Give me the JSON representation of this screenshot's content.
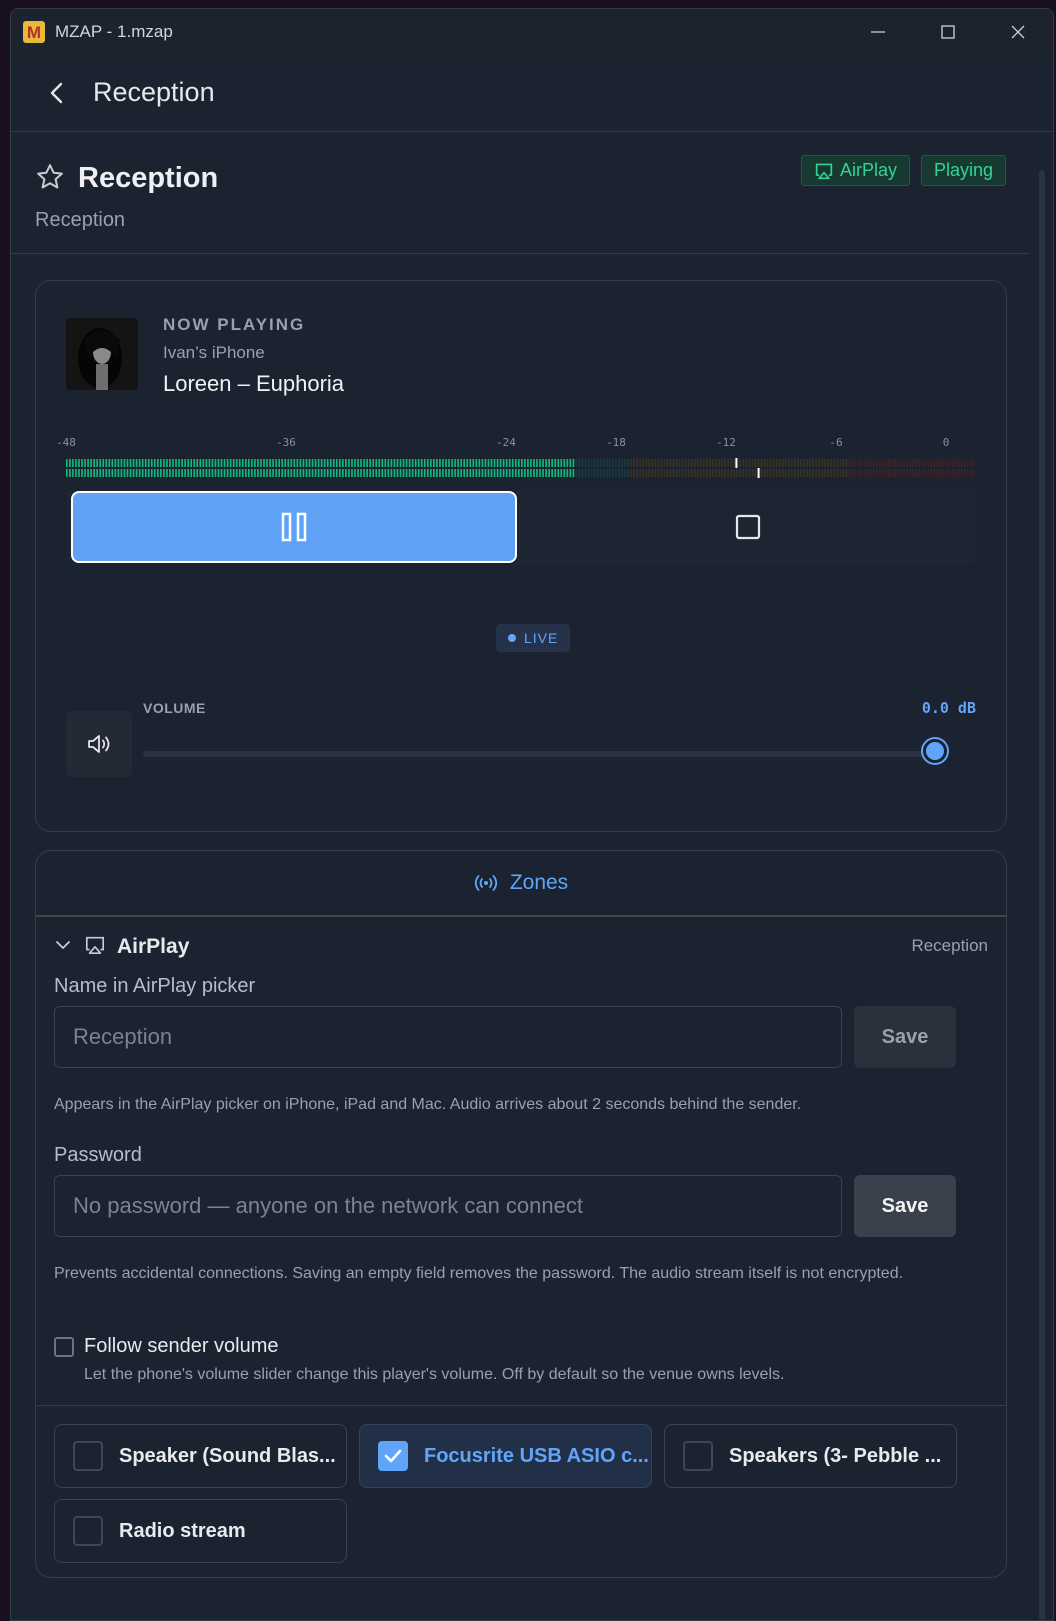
{
  "window": {
    "title": "MZAP - 1.mzap"
  },
  "header": {
    "title": "Reception"
  },
  "page": {
    "title": "Reception",
    "subtitle": "Reception",
    "badges": {
      "airplay": "AirPlay",
      "status": "Playing"
    }
  },
  "now_playing": {
    "label": "NOW PLAYING",
    "source": "Ivan’s iPhone",
    "track": "Loreen – Euphoria",
    "meter_scale": [
      "-48",
      "-36",
      "-24",
      "-18",
      "-12",
      "-6",
      "0"
    ],
    "live_label": "LIVE",
    "volume_label": "VOLUME",
    "volume_value": "0.0 dB",
    "volume_fraction": 0.99,
    "meter_level_fraction": 0.56,
    "meter_peak_fraction": 0.74
  },
  "zones": {
    "title": "Zones",
    "airplay": {
      "title": "AirPlay",
      "right_label": "Reception",
      "name_label": "Name in AirPlay picker",
      "name_placeholder": "Reception",
      "name_save": "Save",
      "name_help": "Appears in the AirPlay picker on iPhone, iPad and Mac. Audio arrives about 2 seconds behind the sender.",
      "password_label": "Password",
      "password_placeholder": "No password — anyone on the network can connect",
      "password_save": "Save",
      "password_help": "Prevents accidental connections. Saving an empty field removes the password. The audio stream itself is not encrypted.",
      "follow_label": "Follow sender volume",
      "follow_help": "Let the phone's volume slider change this player's volume. Off by default so the venue owns levels."
    },
    "outputs": [
      {
        "label": "Speaker (Sound Blas...",
        "selected": false
      },
      {
        "label": "Focusrite USB ASIO c...",
        "selected": true
      },
      {
        "label": "Speakers (3- Pebble ...",
        "selected": false
      },
      {
        "label": "Radio stream",
        "selected": false
      }
    ]
  },
  "colors": {
    "accent": "#60a5fa",
    "success": "#34d399",
    "background": "#1b2230"
  }
}
